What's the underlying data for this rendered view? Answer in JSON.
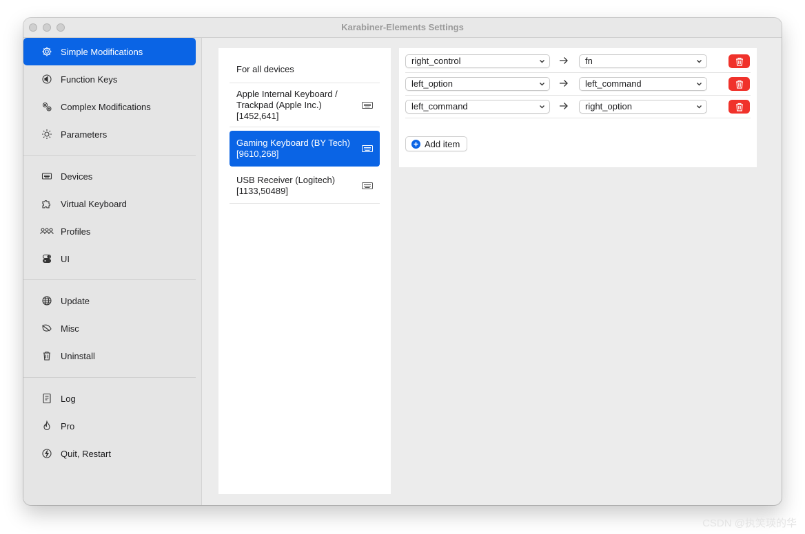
{
  "window": {
    "title": "Karabiner-Elements Settings"
  },
  "sidebar": {
    "items": [
      {
        "label": "Simple Modifications",
        "icon": "gear-icon",
        "selected": true
      },
      {
        "label": "Function Keys",
        "icon": "speaker-icon"
      },
      {
        "label": "Complex Modifications",
        "icon": "gears-icon"
      },
      {
        "label": "Parameters",
        "icon": "sun-icon"
      },
      {
        "label": "Devices",
        "icon": "keyboard-icon"
      },
      {
        "label": "Virtual Keyboard",
        "icon": "puzzle-icon"
      },
      {
        "label": "Profiles",
        "icon": "people-icon"
      },
      {
        "label": "UI",
        "icon": "toggle-icon"
      },
      {
        "label": "Update",
        "icon": "globe-icon"
      },
      {
        "label": "Misc",
        "icon": "leaf-icon"
      },
      {
        "label": "Uninstall",
        "icon": "trash-icon"
      },
      {
        "label": "Log",
        "icon": "document-icon"
      },
      {
        "label": "Pro",
        "icon": "flame-icon"
      },
      {
        "label": "Quit, Restart",
        "icon": "power-icon"
      }
    ]
  },
  "devices": {
    "items": [
      {
        "name": "For all devices"
      },
      {
        "name": "Apple Internal Keyboard / Trackpad (Apple Inc.) [1452,641]",
        "icon": "keyboard-icon"
      },
      {
        "name": "Gaming Keyboard (BY Tech) [9610,268]",
        "icon": "keyboard-icon",
        "selected": true
      },
      {
        "name": "USB Receiver (Logitech) [1133,50489]",
        "icon": "keyboard-icon"
      }
    ]
  },
  "rules": [
    {
      "from": "right_control",
      "to": "fn"
    },
    {
      "from": "left_option",
      "to": "left_command"
    },
    {
      "from": "left_command",
      "to": "right_option"
    }
  ],
  "add_item_label": "Add item",
  "watermark": "CSDN @执笑瑛的华",
  "colors": {
    "accent": "#0a64e5",
    "delete": "#f0322b"
  }
}
